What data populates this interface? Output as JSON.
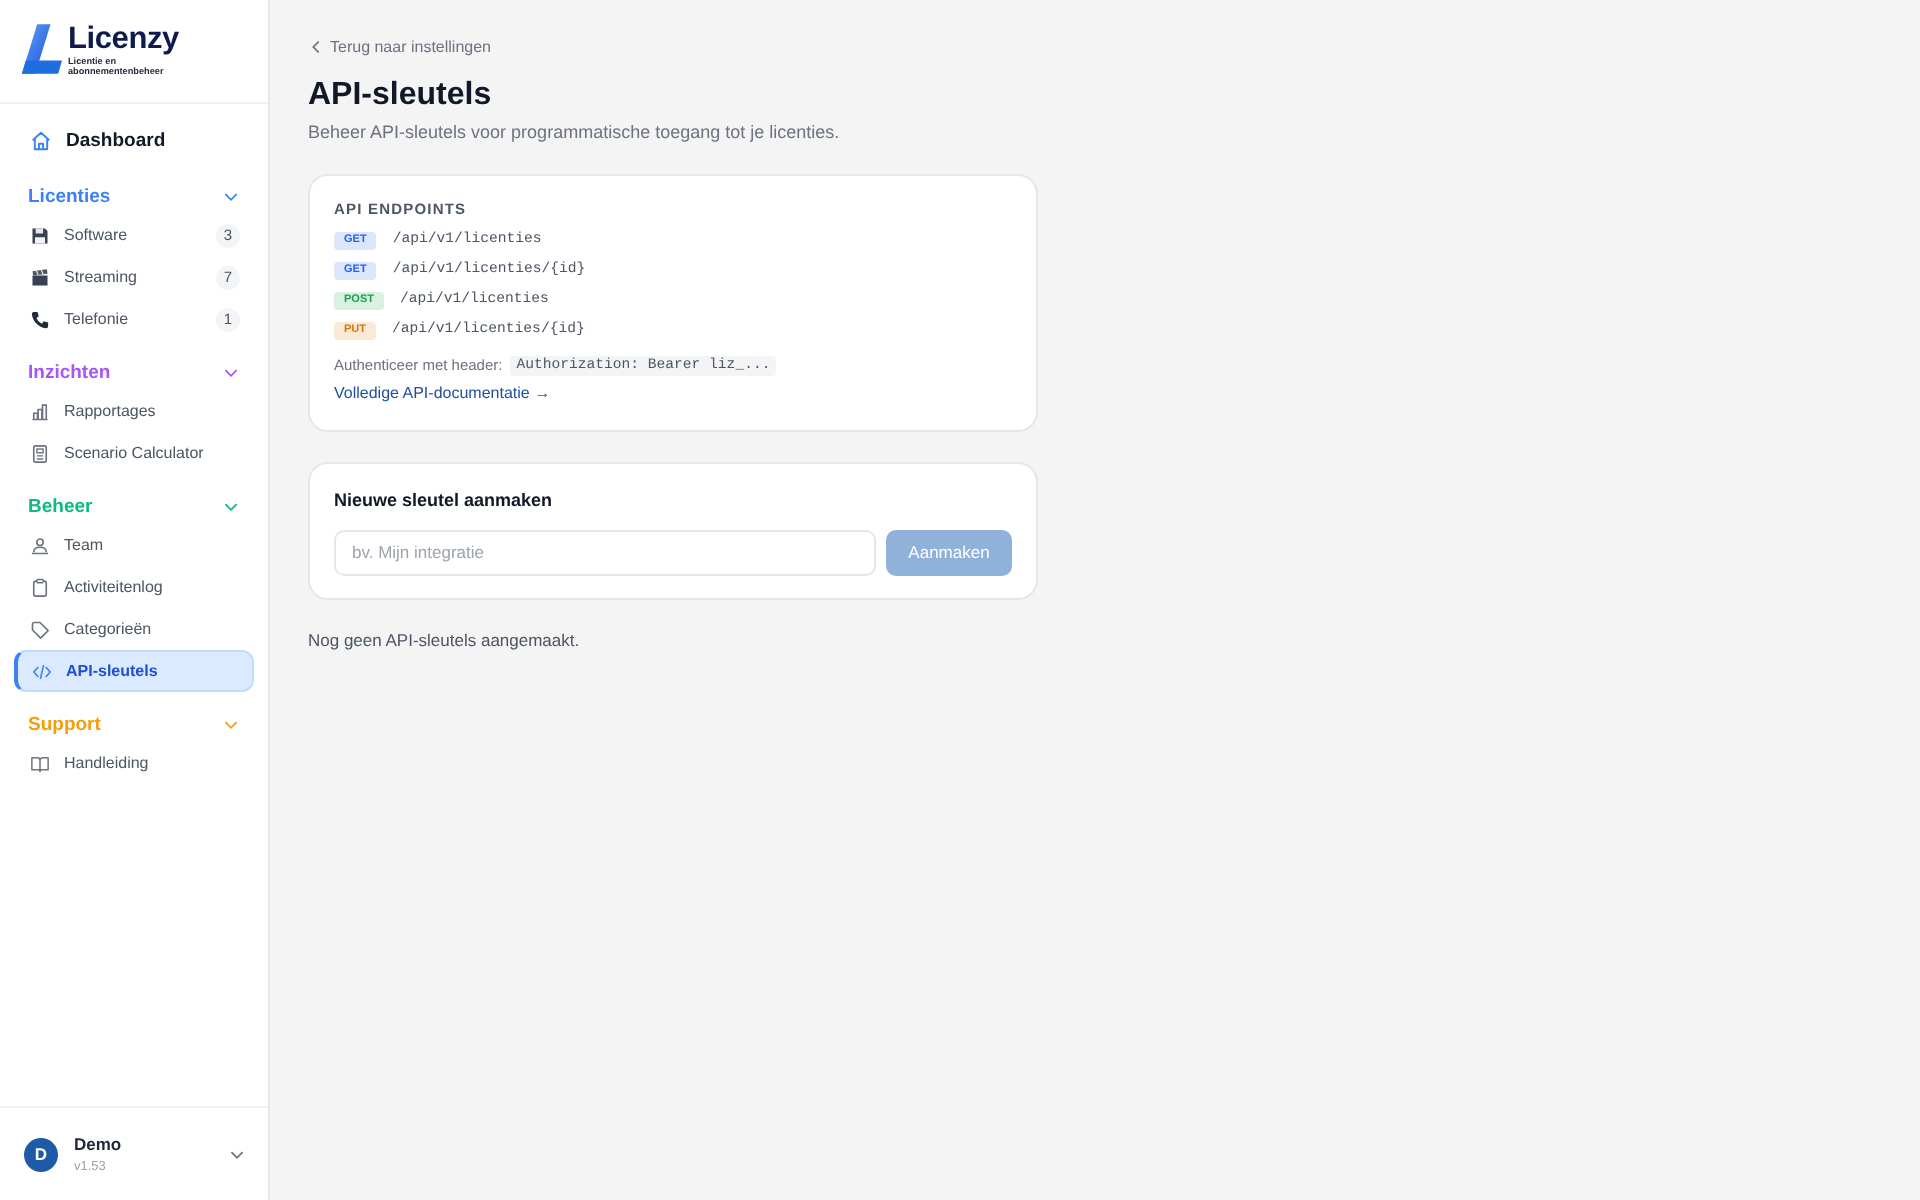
{
  "logo": {
    "name": "Licenzy",
    "tagline": "Licentie en abonnementenbeheer"
  },
  "sidebar": {
    "dashboard": {
      "label": "Dashboard",
      "selected": false
    },
    "groups": [
      {
        "title": "Licenties",
        "color": "#3b82f6",
        "expanded": true,
        "items": [
          {
            "label": "Software",
            "count": "3",
            "selected": false
          },
          {
            "label": "Streaming",
            "count": "7",
            "selected": false
          },
          {
            "label": "Telefonie",
            "count": "1",
            "selected": false
          }
        ]
      },
      {
        "title": "Inzichten",
        "color": "#a855f7",
        "expanded": true,
        "items": [
          {
            "label": "Rapportages",
            "selected": false
          },
          {
            "label": "Scenario Calculator",
            "selected": false
          }
        ]
      },
      {
        "title": "Beheer",
        "color": "#10b981",
        "expanded": true,
        "items": [
          {
            "label": "Team",
            "selected": false
          },
          {
            "label": "Activiteitenlog",
            "selected": false
          },
          {
            "label": "Categorieën",
            "selected": false
          },
          {
            "label": "API-sleutels",
            "selected": true
          }
        ]
      },
      {
        "title": "Support",
        "color": "#f59e0b",
        "expanded": true,
        "items": [
          {
            "label": "Handleiding",
            "selected": false
          }
        ]
      }
    ]
  },
  "user": {
    "initial": "D",
    "name": "Demo",
    "version": "v1.53"
  },
  "back_link": "Terug naar instellingen",
  "title": "API-sleutels",
  "subtitle": "Beheer API-sleutels voor programmatische toegang tot je licenties.",
  "endpoints_card": {
    "heading": "API ENDPOINTS",
    "endpoints": [
      {
        "method": "GET",
        "color": "#2563eb",
        "path": "/api/v1/licenties"
      },
      {
        "method": "GET",
        "color": "#2563eb",
        "path": "/api/v1/licenties/{id}"
      },
      {
        "method": "POST",
        "color": "#16a34a",
        "path": "/api/v1/licenties"
      },
      {
        "method": "PUT",
        "color": "#d97706",
        "path": "/api/v1/licenties/{id}"
      }
    ],
    "auth_label": "Authenticeer met header:",
    "auth_code": "Authorization: Bearer liz_...",
    "docs_link": "Volledige API-documentatie →"
  },
  "create_card": {
    "heading": "Nieuwe sleutel aanmaken",
    "placeholder": "bv. Mijn integratie",
    "button": {
      "label": "Aanmaken",
      "disabled": true
    }
  },
  "empty_message": "Nog geen API-sleutels aangemaakt."
}
